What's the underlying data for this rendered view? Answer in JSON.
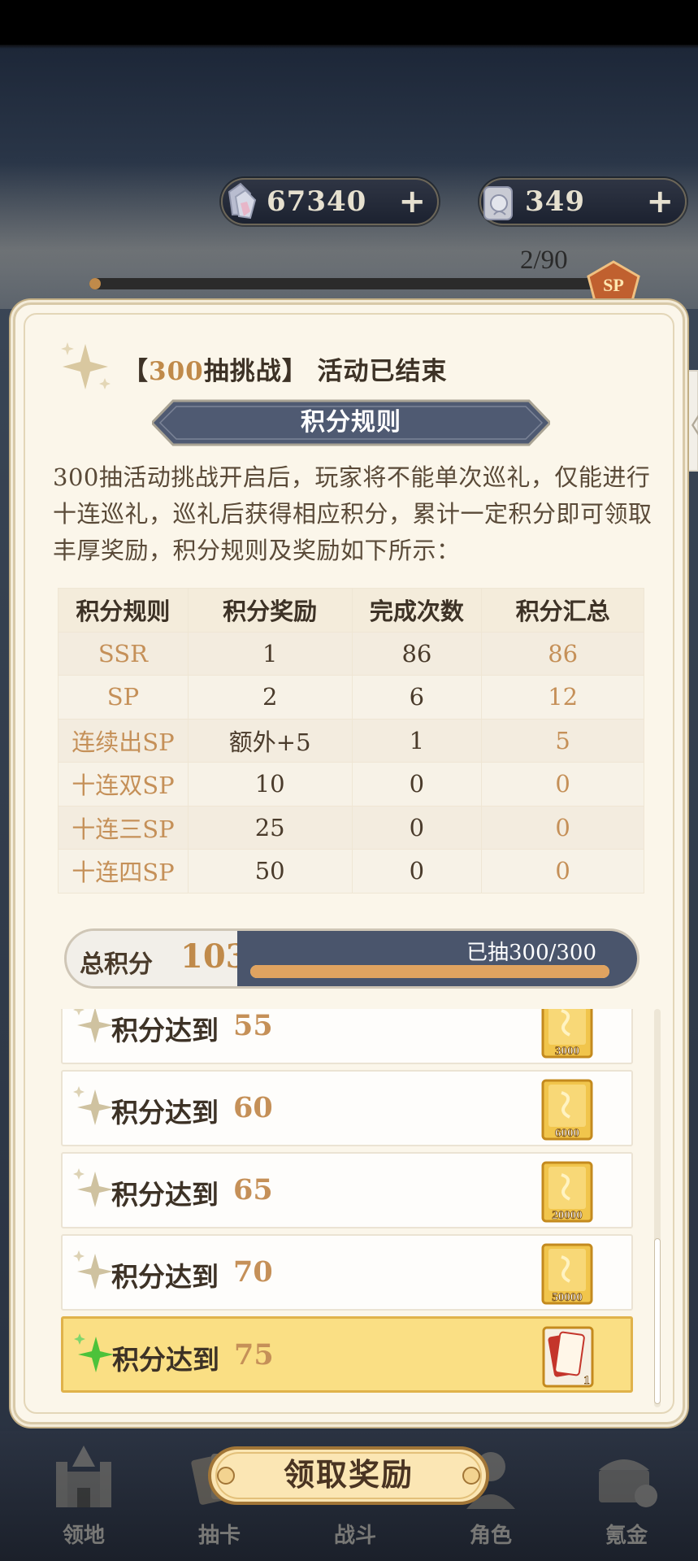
{
  "currencies": {
    "gem": {
      "value": "67340",
      "icon": "crystal-icon",
      "plus": "+"
    },
    "ticket": {
      "value": "349",
      "icon": "scroll-ticket-icon",
      "plus": "+"
    }
  },
  "summon_progress": {
    "text": "2/90",
    "fraction": 0.022,
    "badge": "SP"
  },
  "side_tab": {
    "glyph": "〈"
  },
  "modal": {
    "title_prefix": "【",
    "title_highlight": "300",
    "title_rest": "抽挑战】 活动已结束",
    "rules_banner": "积分规则",
    "description": "300抽活动挑战开启后，玩家将不能单次巡礼，仅能进行十连巡礼，巡礼后获得相应积分，累计一定积分即可领取丰厚奖励，积分规则及奖励如下所示：",
    "table": {
      "headers": [
        "积分规则",
        "积分奖励",
        "完成次数",
        "积分汇总"
      ],
      "rows": [
        [
          "SSR",
          "1",
          "86",
          "86"
        ],
        [
          "SP",
          "2",
          "6",
          "12"
        ],
        [
          "连续出SP",
          "额外+5",
          "1",
          "5"
        ],
        [
          "十连双SP",
          "10",
          "0",
          "0"
        ],
        [
          "十连三SP",
          "25",
          "0",
          "0"
        ],
        [
          "十连四SP",
          "50",
          "0",
          "0"
        ]
      ]
    },
    "total": {
      "label": "总积分",
      "value": "103",
      "pulled": "已抽300/300",
      "pulled_fraction": 1.0
    },
    "milestones": [
      {
        "label": "积分达到",
        "value": "55",
        "reward": "3000",
        "active": false
      },
      {
        "label": "积分达到",
        "value": "60",
        "reward": "6000",
        "active": false
      },
      {
        "label": "积分达到",
        "value": "65",
        "reward": "20000",
        "active": false
      },
      {
        "label": "积分达到",
        "value": "70",
        "reward": "50000",
        "active": false
      },
      {
        "label": "积分达到",
        "value": "75",
        "reward": "1",
        "active": true
      }
    ]
  },
  "claim_button": "领取奖励",
  "nav": [
    {
      "label": "领地",
      "icon": "castle-icon"
    },
    {
      "label": "抽卡",
      "icon": "card-draw-icon"
    },
    {
      "label": "战斗",
      "icon": "battle-icon"
    },
    {
      "label": "角色",
      "icon": "character-icon"
    },
    {
      "label": "氪金",
      "icon": "treasure-chest-icon"
    }
  ],
  "colors": {
    "accent_gold": "#c08a4a",
    "panel_bg": "#fbf6ea",
    "banner_navy": "#4a556c",
    "active_row": "#fadf84",
    "active_sparkle": "#4cc23a"
  }
}
